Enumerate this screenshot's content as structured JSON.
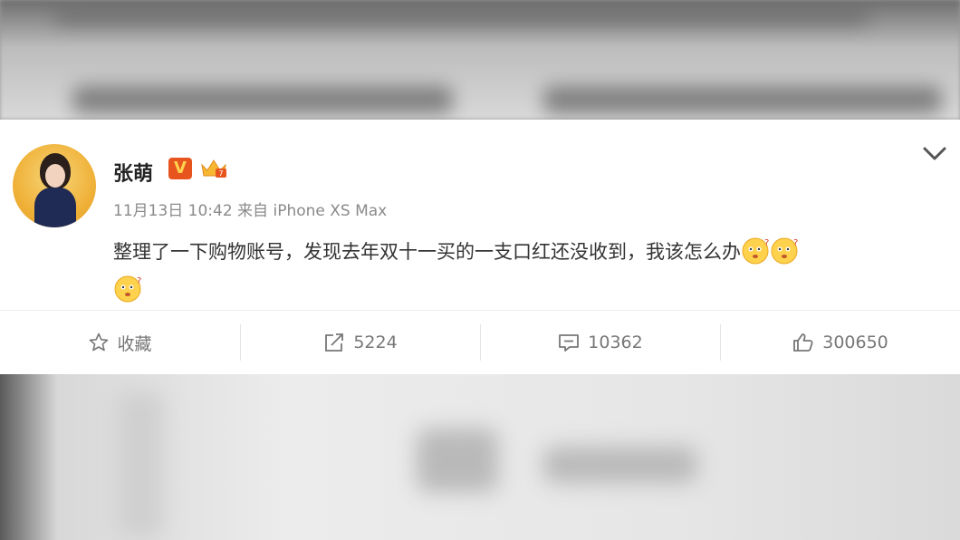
{
  "post": {
    "username": "张萌",
    "verified_badge": "V",
    "meta": "11月13日 10:42 来自 iPhone XS Max",
    "text_line1": "整理了一下购物账号，发现去年双十一买的一支口红还没收到，我该怎么办",
    "emoji_icon": "confused-face-emoji"
  },
  "actions": {
    "favorite_label": "收藏",
    "repost_count": "5224",
    "comment_count": "10362",
    "like_count": "300650"
  },
  "colors": {
    "verified_badge": "#e8541e",
    "badge_text": "#ffd34d",
    "text": "#333333",
    "meta": "#8a8a8a",
    "action": "#777777"
  }
}
